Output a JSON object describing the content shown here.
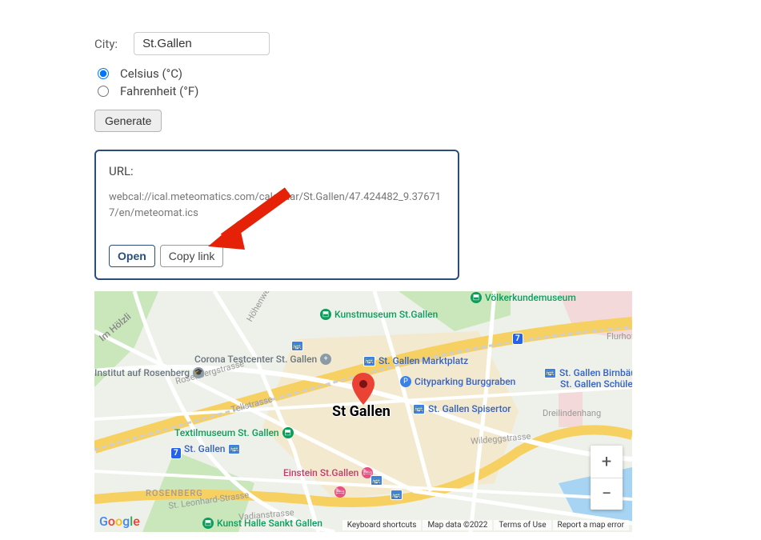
{
  "form": {
    "city_label": "City:",
    "city_value": "St.Gallen",
    "unit_options": [
      {
        "label": "Celsius (°C)",
        "checked": true
      },
      {
        "label": "Fahrenheit (°F)",
        "checked": false
      }
    ],
    "generate_label": "Generate"
  },
  "result": {
    "url_label": "URL:",
    "url_value": "webcal://ical.meteomatics.com/calendar/St.Gallen/47.424482_9.376717/en/meteomat.ics",
    "open_label": "Open",
    "copy_label": "Copy link"
  },
  "map": {
    "city_main": "St Gallen",
    "pois": {
      "kunstmuseum": "Kunstmuseum St.Gallen",
      "volkerkunde": "Völkerkundemuseum",
      "testcenter": "Corona Testcenter St. Gallen",
      "institut": "Institut auf Rosenberg",
      "marktplatz": "St. Gallen Marktplatz",
      "cityparking": "Cityparking Burggraben",
      "birnbaumli": "St. Gallen Birnbäumli",
      "schulertor": "St. Gallen Schülertor",
      "spisertor": "St. Gallen Spisertor",
      "textilmuseum": "Textilmuseum St. Gallen",
      "stgallen_station": "St. Gallen",
      "einstein": "Einstein St.Gallen",
      "kunsthalle": "Kunst Halle Sankt Gallen",
      "imholzli": "Im Hölzli",
      "flurhofstr": "Flurhofstr."
    },
    "roads": {
      "rosenbergstrasse": "Rosenbergstrasse",
      "tellstrasse": "Tellstrasse",
      "hohenweg": "Höhenweg",
      "wildeggstrasse": "Wildeggstrasse",
      "dreilindenhang": "Dreilindenhang",
      "stleonhard": "St. Leonhard-Strasse",
      "vadianstrasse": "Vadianstrasse"
    },
    "districts": {
      "rosenberg": "ROSENBERG"
    },
    "shields": {
      "seven": "7"
    },
    "footer": {
      "shortcuts": "Keyboard shortcuts",
      "mapdata": "Map data ©2022",
      "terms": "Terms of Use",
      "report": "Report a map error"
    },
    "google": "Google"
  }
}
